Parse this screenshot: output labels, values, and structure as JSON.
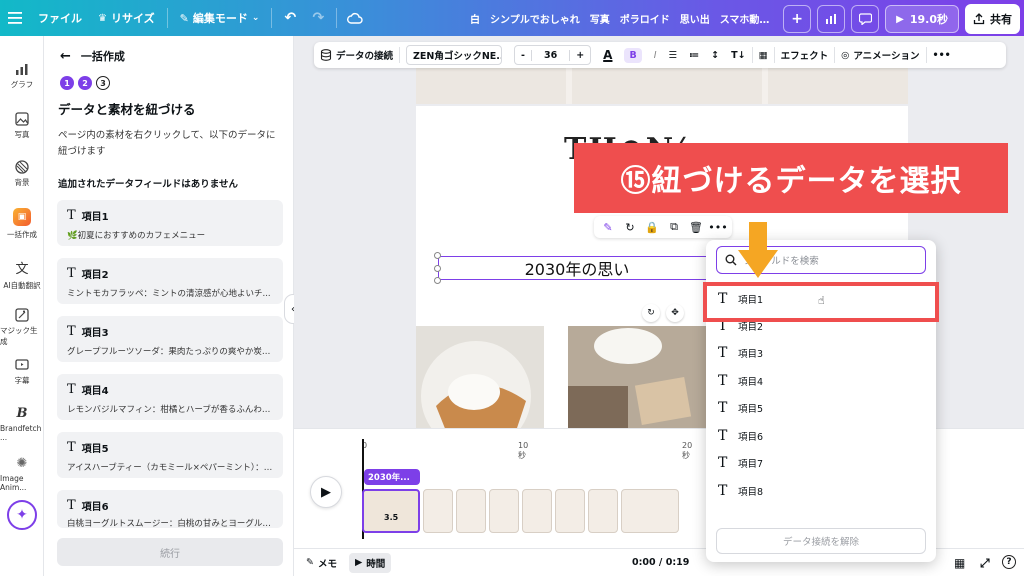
{
  "topbar": {
    "file_label": "ファイル",
    "resize_label": "リサイズ",
    "edit_mode_label": "編集モード",
    "doc_title": "白　シンプルでおしゃれ　写真　ポラロイド　思い出　スマホ動…",
    "duration_label": "19.0秒",
    "share_label": "共有"
  },
  "rail": {
    "items": [
      {
        "label": "グラフ",
        "icon": "chart-icon"
      },
      {
        "label": "写真",
        "icon": "photo-icon"
      },
      {
        "label": "背景",
        "icon": "background-icon"
      },
      {
        "label": "一括作成",
        "icon": "bulk-create-icon"
      },
      {
        "label": "AI自動翻訳",
        "icon": "translate-icon"
      },
      {
        "label": "マジック生成",
        "icon": "magic-generate-icon"
      },
      {
        "label": "字幕",
        "icon": "caption-icon"
      },
      {
        "label": "Brandfetch ...",
        "icon": "brandfetch-icon"
      },
      {
        "label": "Image Anim...",
        "icon": "image-animate-icon"
      }
    ]
  },
  "panel": {
    "back_label": "一括作成",
    "steps": [
      "1",
      "2",
      "3"
    ],
    "title": "データと素材を紐づける",
    "description": "ページ内の素材を右クリックして、以下のデータに紐づけます",
    "note": "追加されたデータフィールドはありません",
    "cards": [
      {
        "title": "項目1",
        "sub": "🌿初夏におすすめのカフェメニュー"
      },
      {
        "title": "項目2",
        "sub": "ミントモカフラッペ：ミントの清涼感が心地よいチ..."
      },
      {
        "title": "項目3",
        "sub": "グレープフルーツソーダ：果肉たっぷりの爽やか炭酸..."
      },
      {
        "title": "項目4",
        "sub": "レモンバジルマフィン：柑橘とハーブが香るふんわり..."
      },
      {
        "title": "項目5",
        "sub": "アイスハーブティー（カモミール×ペパーミント）：や..."
      },
      {
        "title": "項目6",
        "sub": "白桃ヨーグルトスムージー：白桃の甘みとヨーグルト..."
      }
    ],
    "continue_label": "続行"
  },
  "toolbar": {
    "data_link_label": "データの接続",
    "font_name": "ZEN角ゴシックNE...",
    "font_size": "36",
    "minus": "-",
    "plus": "+",
    "effect_label": "エフェクト",
    "animation_label": "アニメーション"
  },
  "canvas": {
    "title_art": "TH⊘N⁄",
    "text_box_value": "2030年の思い"
  },
  "callout": {
    "text": "⑮紐づけるデータを選択",
    "color": "#ef4e4e"
  },
  "dropdown": {
    "search_placeholder": "フィールドを検索",
    "fields": [
      "項目1",
      "項目2",
      "項目3",
      "項目4",
      "項目5",
      "項目6",
      "項目7",
      "項目8"
    ],
    "unlink_label": "データ接続を解除"
  },
  "timeline": {
    "clip_label": "2030年...",
    "clip_duration": "3.5",
    "ticks": [
      "0",
      "10秒",
      "20秒"
    ]
  },
  "bottombar": {
    "memo_label": "メモ",
    "time_label": "時間",
    "time_readout": "0:00 / 0:19"
  },
  "colors": {
    "accent": "#7d3fe8",
    "highlight": "#ef4e4e",
    "arrow": "#f5a623"
  }
}
